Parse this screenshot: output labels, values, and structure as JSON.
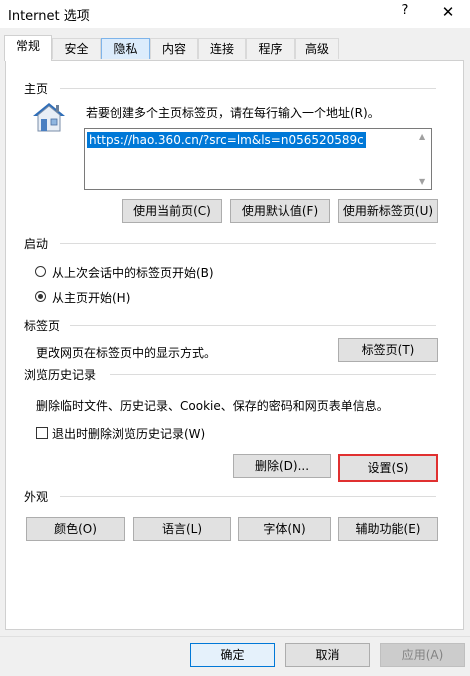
{
  "window": {
    "title": "Internet 选项",
    "help": "?",
    "close": "✕"
  },
  "tabs": [
    "常规",
    "安全",
    "隐私",
    "内容",
    "连接",
    "程序",
    "高级"
  ],
  "home": {
    "legend": "主页",
    "instruction": "若要创建多个主页标签页，请在每行输入一个地址(R)。",
    "url": "https://hao.360.cn/?src=lm&ls=n056520589c",
    "buttons": [
      "使用当前页(C)",
      "使用默认值(F)",
      "使用新标签页(U)"
    ]
  },
  "startup": {
    "legend": "启动",
    "options": [
      "从上次会话中的标签页开始(B)",
      "从主页开始(H)"
    ],
    "selected": 1
  },
  "tabsSection": {
    "legend": "标签页",
    "description": "更改网页在标签页中的显示方式。",
    "button": "标签页(T)"
  },
  "history": {
    "legend": "浏览历史记录",
    "description": "删除临时文件、历史记录、Cookie、保存的密码和网页表单信息。",
    "checkbox": "退出时删除浏览历史记录(W)",
    "checked": false,
    "delete": "删除(D)...",
    "settings": "设置(S)"
  },
  "appearance": {
    "legend": "外观",
    "buttons": [
      "颜色(O)",
      "语言(L)",
      "字体(N)",
      "辅助功能(E)"
    ]
  },
  "footer": {
    "ok": "确定",
    "cancel": "取消",
    "apply": "应用(A)"
  },
  "colors": {
    "selection": "#0078d7",
    "focus_ring": "#e03030",
    "tab_hover": "#dcecfc"
  }
}
